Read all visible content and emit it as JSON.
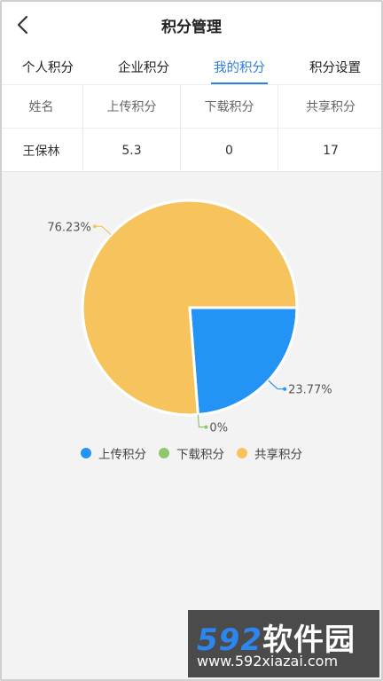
{
  "header": {
    "title": "积分管理",
    "back_icon": "chevron-left-icon"
  },
  "tabs": [
    {
      "label": "个人积分",
      "active": false
    },
    {
      "label": "企业积分",
      "active": false
    },
    {
      "label": "我的积分",
      "active": true
    },
    {
      "label": "积分设置",
      "active": false
    }
  ],
  "table": {
    "headers": [
      "姓名",
      "上传积分",
      "下载积分",
      "共享积分"
    ],
    "row": [
      "王保林",
      "5.3",
      "0",
      "17"
    ]
  },
  "chart_data": {
    "type": "pie",
    "slices": [
      {
        "name": "上传积分",
        "percent": 23.77,
        "label": "23.77%",
        "color": "#2394f5"
      },
      {
        "name": "下载积分",
        "percent": 0,
        "label": "0%",
        "color": "#8dc96a"
      },
      {
        "name": "共享积分",
        "percent": 76.23,
        "label": "76.23%",
        "color": "#f6c35c"
      }
    ],
    "legend": [
      "上传积分",
      "下载积分",
      "共享积分"
    ]
  },
  "watermark": {
    "brand_num": "592",
    "brand_cn": "软件园",
    "url": "www.592xiazai.com"
  },
  "colors": {
    "accent": "#2e7ee8"
  }
}
